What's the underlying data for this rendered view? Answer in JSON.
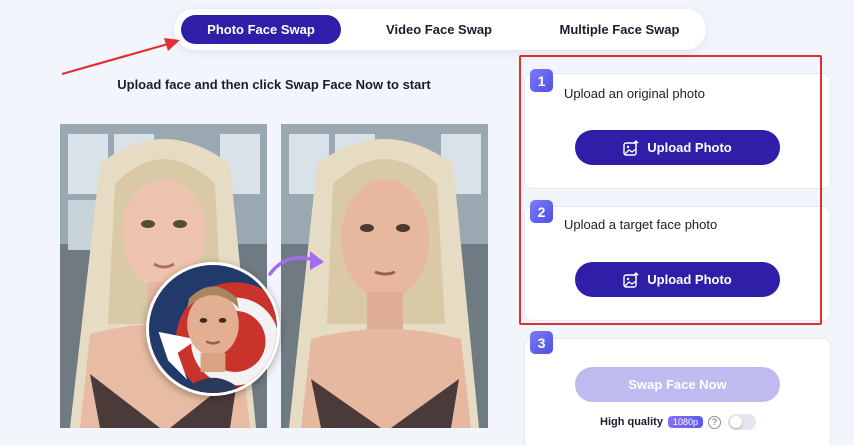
{
  "tabs": [
    {
      "label": "Photo Face Swap",
      "active": true
    },
    {
      "label": "Video Face Swap",
      "active": false
    },
    {
      "label": "Multiple Face Swap",
      "active": false
    }
  ],
  "instruction": "Upload face and then click Swap Face Now to start",
  "steps": [
    {
      "number": "1",
      "label": "Upload an original photo",
      "button": "Upload Photo"
    },
    {
      "number": "2",
      "label": "Upload a target face photo",
      "button": "Upload Photo"
    },
    {
      "number": "3",
      "button": "Swap Face Now"
    }
  ],
  "high_quality": {
    "label": "High quality",
    "badge": "1080p",
    "help": "?",
    "enabled": false
  },
  "colors": {
    "primary": "#2f1fa8",
    "primary_disabled": "#bfbaf0",
    "annotation": "#e03030",
    "swap_arrow": "#a46cf0"
  },
  "icons": {
    "upload": "image-upload-icon",
    "help": "help-icon",
    "swap": "curved-arrow-icon"
  }
}
